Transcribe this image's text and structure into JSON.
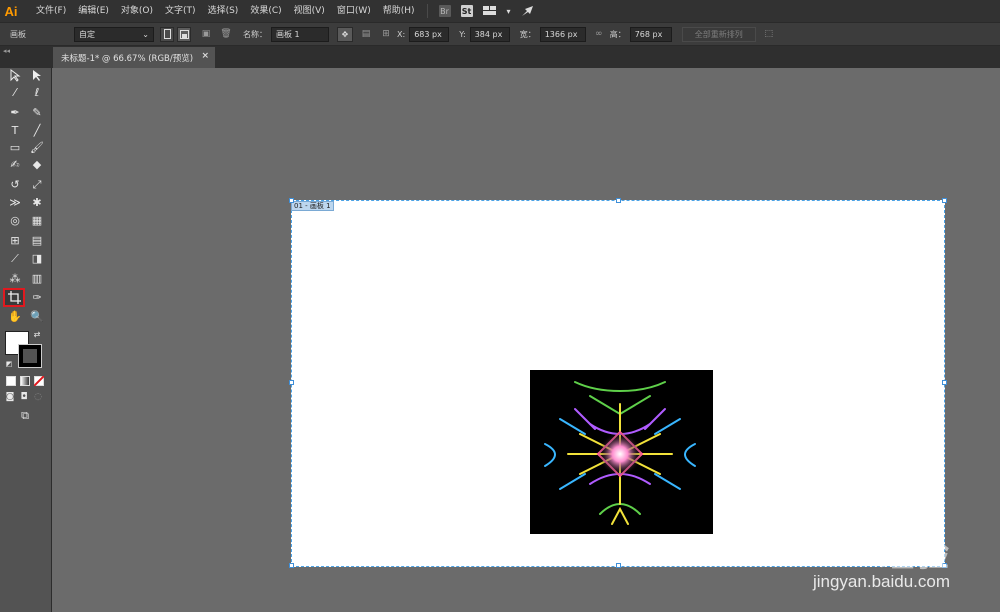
{
  "app": {
    "logo": "Ai"
  },
  "menu": [
    "文件(F)",
    "编辑(E)",
    "对象(O)",
    "文字(T)",
    "选择(S)",
    "效果(C)",
    "视图(V)",
    "窗口(W)",
    "帮助(H)"
  ],
  "menubar_icons": {
    "br": "Br",
    "st": "St",
    "layout_arrow": "▾"
  },
  "control": {
    "panel_label": "画板",
    "preset": "自定",
    "name_label": "名称：",
    "name_value": "画板 1",
    "x_label": "X:",
    "x_value": "683 px",
    "y_label": "Y:",
    "y_value": "384 px",
    "w_label": "宽：",
    "w_value": "1366 px",
    "h_label": "高：",
    "h_value": "768 px",
    "rearrange_button": "全部重新排列"
  },
  "document": {
    "tab_title": "未标题-1* @ 66.67% (RGB/预览)",
    "close": "×",
    "artboard_label": "01 - 画板 1"
  },
  "watermark": {
    "brand": "Bai du 经验",
    "url": "jingyan.baidu.com"
  },
  "colors": {
    "accent_logo": "#ff9a00",
    "selection_blue": "#3f8fd8",
    "highlight_red": "#e0191f"
  }
}
